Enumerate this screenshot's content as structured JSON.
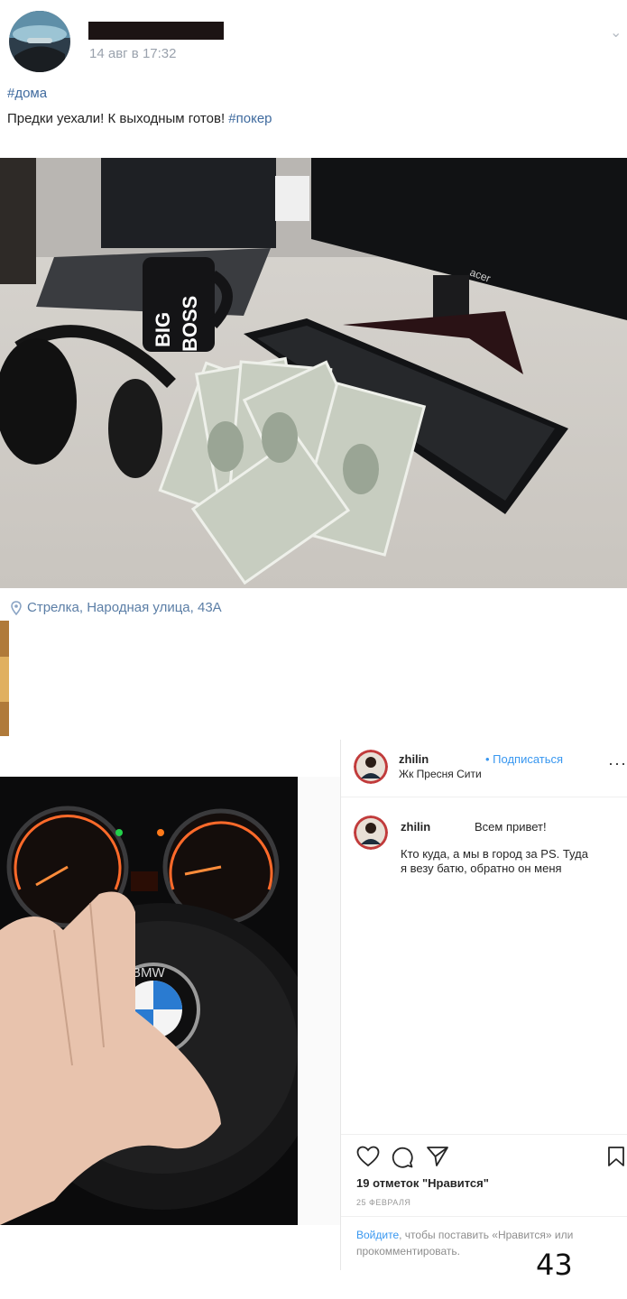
{
  "vk_post": {
    "date": "14 авг в 17:32",
    "hashtag": "#дома",
    "text": "Предки уехали! К выходным готов! ",
    "text_tag": "#покер",
    "location": "Стрелка, Народная улица, 43А"
  },
  "instagram": {
    "username": "zhilin",
    "follow_label": "Подписаться",
    "location": "Жк Пресня Сити",
    "comment_user": "zhilin",
    "comment_line1": "Всем привет!",
    "comment_line2": "Кто куда, а мы в город за PS. Туда",
    "comment_line3": "я везу батю, обратно он меня",
    "likes": "19 отметок \"Нравится\"",
    "date": "25 ФЕВРАЛЯ",
    "login_link": "Войдите",
    "login_rest1": ", чтобы поставить «Нравится» или",
    "login_rest2": "прокомментировать."
  },
  "photos": {
    "mug_line1": "BIG",
    "mug_line2": "BOSS",
    "monitor_brand": "acer",
    "car_brand": "BMW"
  },
  "page_number": "43",
  "colors": {
    "vk_link": "#3f6a9e",
    "ig_link": "#3897f0",
    "redaction": "#1c1414"
  }
}
